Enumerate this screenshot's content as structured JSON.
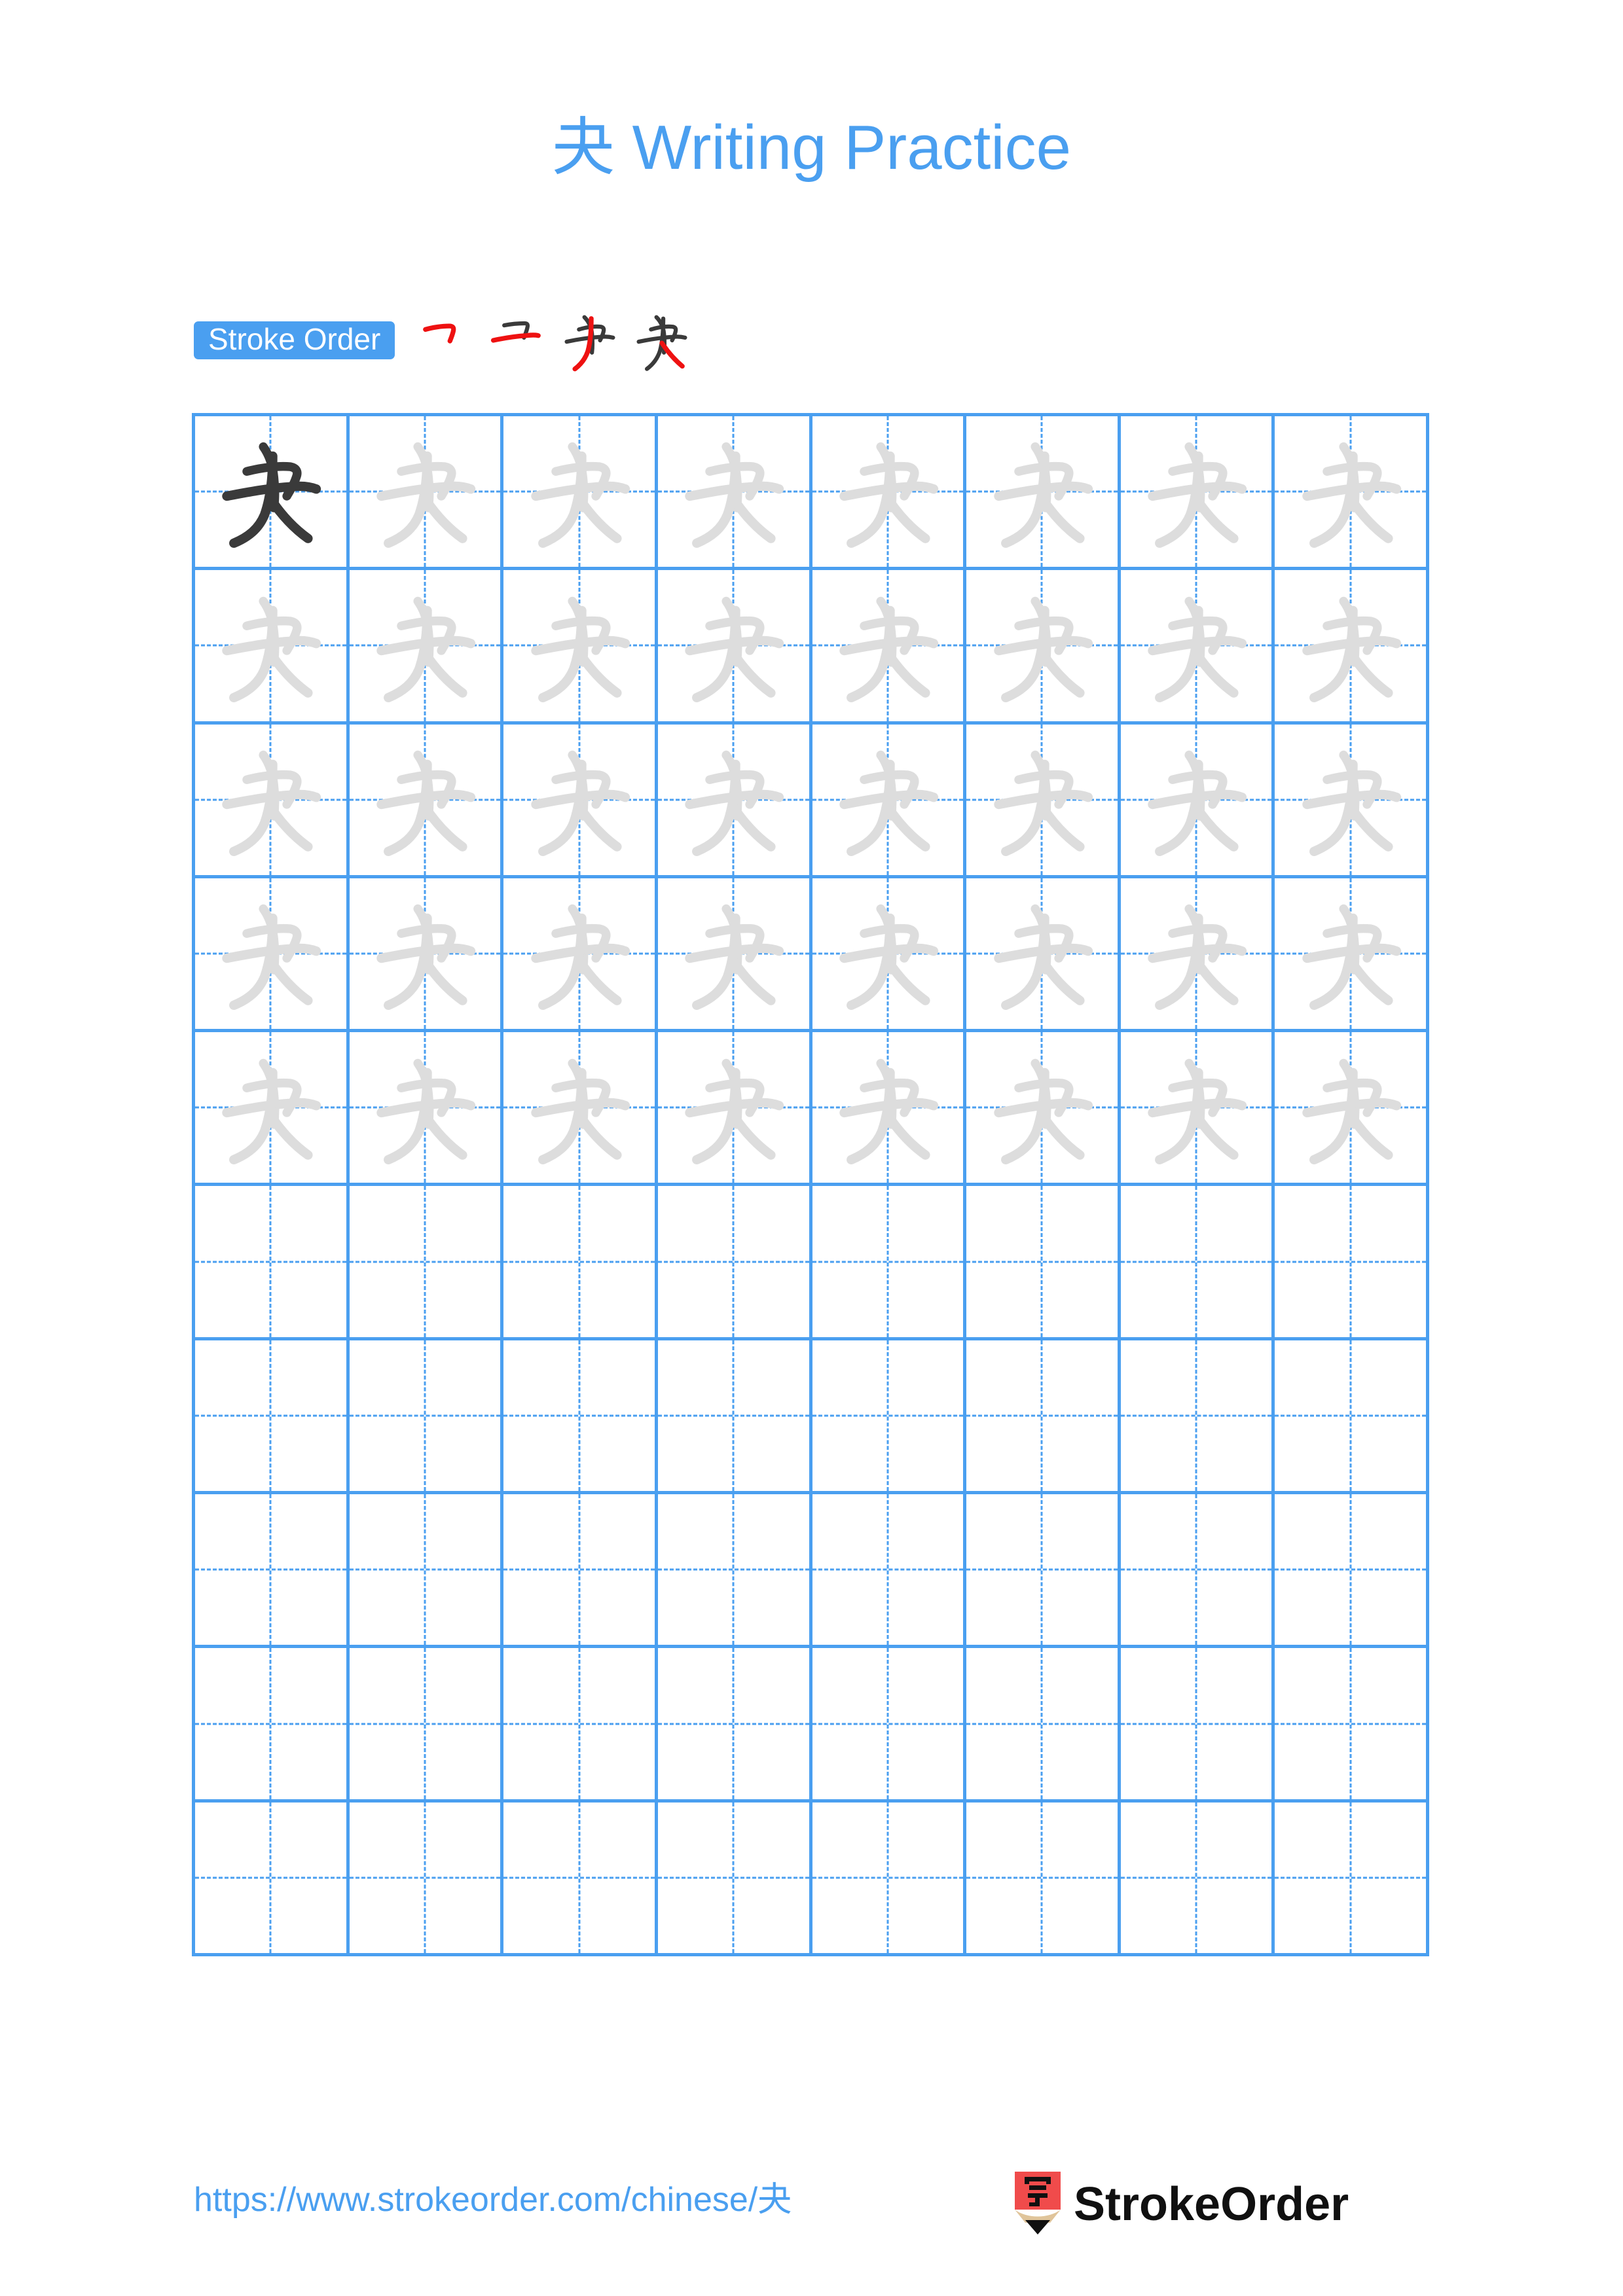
{
  "page": {
    "background_color": "#ffffff",
    "accent_color": "#4a9ff0",
    "grid_line_color": "#4a9ff0",
    "trace_glyph_color": "#dddddd",
    "model_glyph_color": "#3a3a3a",
    "stroke_highlight_color": "#ee1111",
    "stroke_past_color": "#3a3a3a"
  },
  "header": {
    "character": "夬",
    "title": "夬 Writing Practice"
  },
  "stroke_order": {
    "badge_label": "Stroke Order",
    "step_count": 4,
    "steps": [
      {
        "index": 1,
        "strokes_shown": 1,
        "new_stroke_index": 1,
        "name": "heng-zhe"
      },
      {
        "index": 2,
        "strokes_shown": 2,
        "new_stroke_index": 2,
        "name": "heng"
      },
      {
        "index": 3,
        "strokes_shown": 3,
        "new_stroke_index": 3,
        "name": "pie"
      },
      {
        "index": 4,
        "strokes_shown": 4,
        "new_stroke_index": 4,
        "name": "na"
      }
    ]
  },
  "practice_grid": {
    "columns": 8,
    "rows": 10,
    "guide_style": "dashed-cross",
    "rows_data": [
      {
        "row": 1,
        "cells": [
          "model",
          "trace",
          "trace",
          "trace",
          "trace",
          "trace",
          "trace",
          "trace"
        ]
      },
      {
        "row": 2,
        "cells": [
          "trace",
          "trace",
          "trace",
          "trace",
          "trace",
          "trace",
          "trace",
          "trace"
        ]
      },
      {
        "row": 3,
        "cells": [
          "trace",
          "trace",
          "trace",
          "trace",
          "trace",
          "trace",
          "trace",
          "trace"
        ]
      },
      {
        "row": 4,
        "cells": [
          "trace",
          "trace",
          "trace",
          "trace",
          "trace",
          "trace",
          "trace",
          "trace"
        ]
      },
      {
        "row": 5,
        "cells": [
          "trace",
          "trace",
          "trace",
          "trace",
          "trace",
          "trace",
          "trace",
          "trace"
        ]
      },
      {
        "row": 6,
        "cells": [
          "empty",
          "empty",
          "empty",
          "empty",
          "empty",
          "empty",
          "empty",
          "empty"
        ]
      },
      {
        "row": 7,
        "cells": [
          "empty",
          "empty",
          "empty",
          "empty",
          "empty",
          "empty",
          "empty",
          "empty"
        ]
      },
      {
        "row": 8,
        "cells": [
          "empty",
          "empty",
          "empty",
          "empty",
          "empty",
          "empty",
          "empty",
          "empty"
        ]
      },
      {
        "row": 9,
        "cells": [
          "empty",
          "empty",
          "empty",
          "empty",
          "empty",
          "empty",
          "empty",
          "empty"
        ]
      },
      {
        "row": 10,
        "cells": [
          "empty",
          "empty",
          "empty",
          "empty",
          "empty",
          "empty",
          "empty",
          "empty"
        ]
      }
    ]
  },
  "footer": {
    "url": "https://www.strokeorder.com/chinese/夬",
    "brand_name": "StrokeOrder",
    "logo_character": "字",
    "logo_body_color": "#f04b4b",
    "logo_wood_color": "#e0c49a",
    "logo_tip_color": "#101010"
  }
}
